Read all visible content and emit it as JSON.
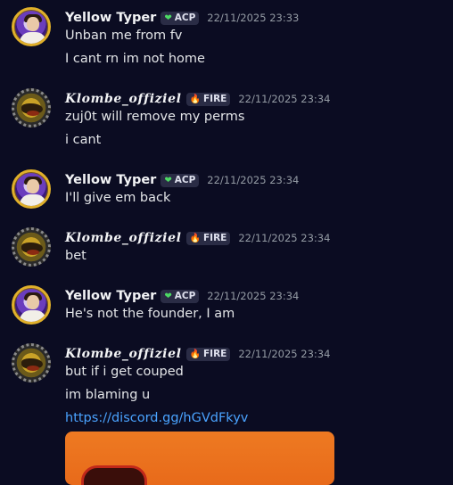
{
  "messages": [
    {
      "user": "Yellow Typer",
      "tag": "ACP",
      "tag_icon": "green-heart-icon",
      "timestamp": "22/11/2025 23:33",
      "lines": [
        "Unban me from fv",
        "I cant rn im not home"
      ]
    },
    {
      "user": "Klombe_offiziel",
      "tag": "FIRE",
      "tag_icon": "flame-icon",
      "timestamp": "22/11/2025 23:34",
      "lines": [
        "zuj0t will remove my perms",
        "i cant"
      ]
    },
    {
      "user": "Yellow Typer",
      "tag": "ACP",
      "tag_icon": "green-heart-icon",
      "timestamp": "22/11/2025 23:34",
      "lines": [
        "I'll give em back"
      ]
    },
    {
      "user": "Klombe_offiziel",
      "tag": "FIRE",
      "tag_icon": "flame-icon",
      "timestamp": "22/11/2025 23:34",
      "lines": [
        "bet"
      ]
    },
    {
      "user": "Yellow Typer",
      "tag": "ACP",
      "tag_icon": "green-heart-icon",
      "timestamp": "22/11/2025 23:34",
      "lines": [
        "He's not the founder, I am"
      ]
    },
    {
      "user": "Klombe_offiziel",
      "tag": "FIRE",
      "tag_icon": "flame-icon",
      "timestamp": "22/11/2025 23:34",
      "lines": [
        "but if i get couped",
        "im blaming u"
      ],
      "link": "https://discord.gg/hGVdFkyv"
    }
  ],
  "colors": {
    "background": "#0b0c22",
    "link": "#4aa3ff",
    "embed": "#ee7a22",
    "acp_heart": "#4cd964",
    "fire": "#ff6a3c"
  }
}
